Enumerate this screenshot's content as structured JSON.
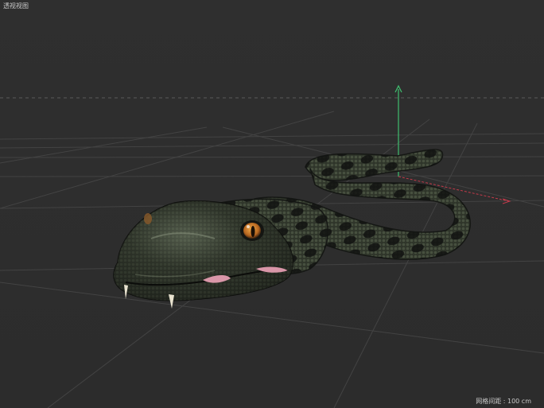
{
  "viewport": {
    "title": "透视视图",
    "grid_spacing_label": "网格间距 : 100 cm"
  },
  "colors": {
    "background": "#2e2e2e",
    "grid_line": "#444444",
    "horizon": "#555555",
    "axis_y": "#3fbf6f",
    "axis_x": "#c23a4a",
    "snake_dark": "#1a1c17",
    "snake_mid": "#3b4233",
    "snake_highlight": "#6a7660",
    "eye": "#c8792a",
    "mouth": "#d996a8"
  },
  "scene_object": {
    "icon": "snake-model-icon"
  }
}
